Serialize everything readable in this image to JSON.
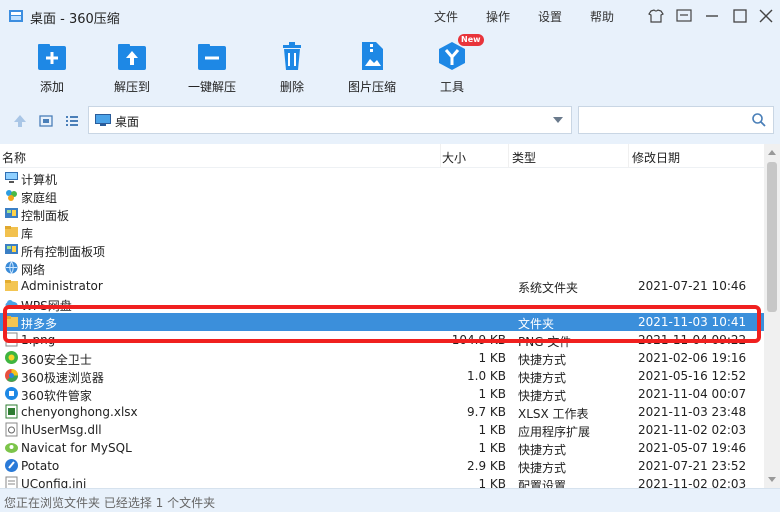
{
  "window": {
    "title": "桌面 - 360压缩",
    "menu": [
      "文件",
      "操作",
      "设置",
      "帮助"
    ]
  },
  "toolbar": {
    "items": [
      {
        "label": "添加",
        "icon": "add-archive-icon"
      },
      {
        "label": "解压到",
        "icon": "extract-to-icon"
      },
      {
        "label": "一键解压",
        "icon": "one-click-extract-icon"
      },
      {
        "label": "删除",
        "icon": "trash-icon"
      },
      {
        "label": "图片压缩",
        "icon": "image-compress-icon"
      },
      {
        "label": "工具",
        "icon": "tools-icon",
        "badge": "New"
      }
    ]
  },
  "navbar": {
    "path": "桌面",
    "search_placeholder": ""
  },
  "columns": {
    "name": "名称",
    "size": "大小",
    "type": "类型",
    "modified": "修改日期"
  },
  "files": [
    {
      "name": "计算机",
      "size": "",
      "type": "",
      "date": "",
      "icon": "computer-icon"
    },
    {
      "name": "家庭组",
      "size": "",
      "type": "",
      "date": "",
      "icon": "homegroup-icon"
    },
    {
      "name": "控制面板",
      "size": "",
      "type": "",
      "date": "",
      "icon": "control-panel-icon"
    },
    {
      "name": "库",
      "size": "",
      "type": "",
      "date": "",
      "icon": "library-icon"
    },
    {
      "name": "所有控制面板项",
      "size": "",
      "type": "",
      "date": "",
      "icon": "control-panel-icon"
    },
    {
      "name": "网络",
      "size": "",
      "type": "",
      "date": "",
      "icon": "network-icon"
    },
    {
      "name": "Administrator",
      "size": "",
      "type": "系统文件夹",
      "date": "2021-07-21 10:46",
      "icon": "folder-icon"
    },
    {
      "name": "WPS网盘",
      "size": "",
      "type": "",
      "date": "",
      "icon": "cloud-drive-icon"
    },
    {
      "name": "拼多多",
      "size": "",
      "type": "文件夹",
      "date": "2021-11-03 10:41",
      "icon": "folder-icon",
      "selected": true
    },
    {
      "name": "1.png",
      "size": "104.9 KB",
      "type": "PNG 文件",
      "date": "2021-11-04 09:22",
      "icon": "image-file-icon"
    },
    {
      "name": "360安全卫士",
      "size": "1 KB",
      "type": "快捷方式",
      "date": "2021-02-06 19:16",
      "icon": "360-safe-icon"
    },
    {
      "name": "360极速浏览器",
      "size": "1.0 KB",
      "type": "快捷方式",
      "date": "2021-05-16 12:52",
      "icon": "browser-icon"
    },
    {
      "name": "360软件管家",
      "size": "1 KB",
      "type": "快捷方式",
      "date": "2021-11-04 00:07",
      "icon": "software-manager-icon"
    },
    {
      "name": "chenyonghong.xlsx",
      "size": "9.7 KB",
      "type": "XLSX 工作表",
      "date": "2021-11-03 23:48",
      "icon": "excel-file-icon"
    },
    {
      "name": "lhUserMsg.dll",
      "size": "1 KB",
      "type": "应用程序扩展",
      "date": "2021-11-02 02:03",
      "icon": "dll-file-icon"
    },
    {
      "name": "Navicat for MySQL",
      "size": "1 KB",
      "type": "快捷方式",
      "date": "2021-05-07 19:46",
      "icon": "navicat-icon"
    },
    {
      "name": "Potato",
      "size": "2.9 KB",
      "type": "快捷方式",
      "date": "2021-07-21 23:52",
      "icon": "potato-icon"
    },
    {
      "name": "UConfig.ini",
      "size": "1 KB",
      "type": "配置设置",
      "date": "2021-11-02 02:03",
      "icon": "ini-file-icon"
    }
  ],
  "status": {
    "text": "您正在浏览文件夹 已经选择 1 个文件夹"
  }
}
